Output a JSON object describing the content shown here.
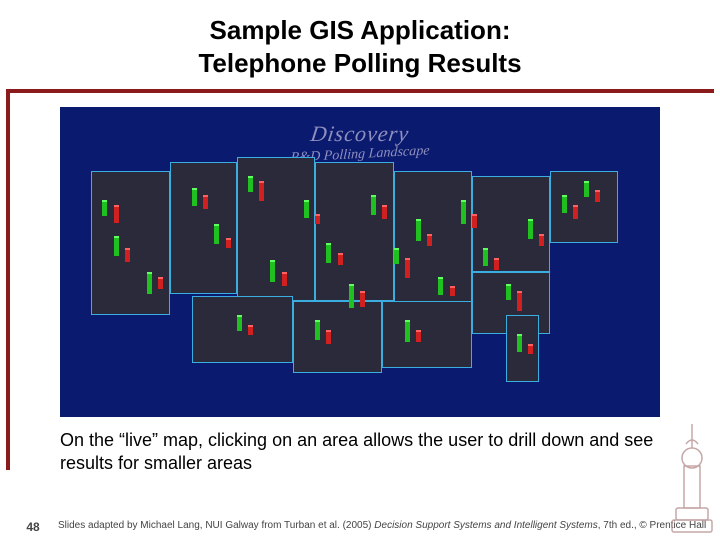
{
  "title_line1": "Sample GIS Application:",
  "title_line2": "Telephone Polling Results",
  "map": {
    "brand": "Discovery",
    "subtitle": "R&D Polling Landscape"
  },
  "caption": "On the “live” map, clicking on an area allows the user to drill down and see results for smaller areas",
  "footer": {
    "page_number": "48",
    "credits_prefix": "Slides adapted by Michael Lang, NUI Galway from Turban et al. (2005) ",
    "credits_title": "Decision Support Systems and Intelligent Systems",
    "credits_suffix": ", 7th ed., © Prentice Hall"
  }
}
